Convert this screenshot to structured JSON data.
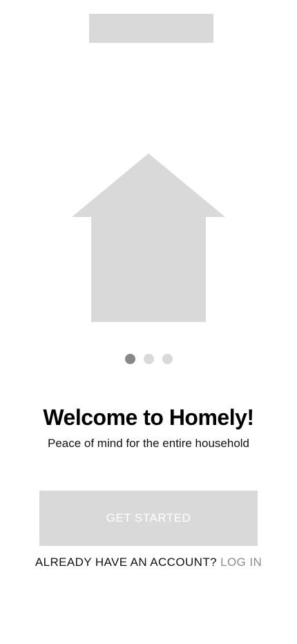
{
  "app": {
    "name": "Homely"
  },
  "header": {
    "logo_placeholder": "logo-placeholder"
  },
  "hero": {
    "illustration": "house-icon",
    "color": "#d9d9d9"
  },
  "pager": {
    "count": 3,
    "active_index": 0,
    "active_color": "#888888",
    "inactive_color": "#d9d9d9"
  },
  "content": {
    "title": "Welcome to Homely!",
    "subtitle": "Peace of mind for the entire household"
  },
  "actions": {
    "get_started_label": "GET STARTED",
    "already_have_account": "ALREADY HAVE AN ACCOUNT?",
    "log_in_label": "LOG IN"
  }
}
